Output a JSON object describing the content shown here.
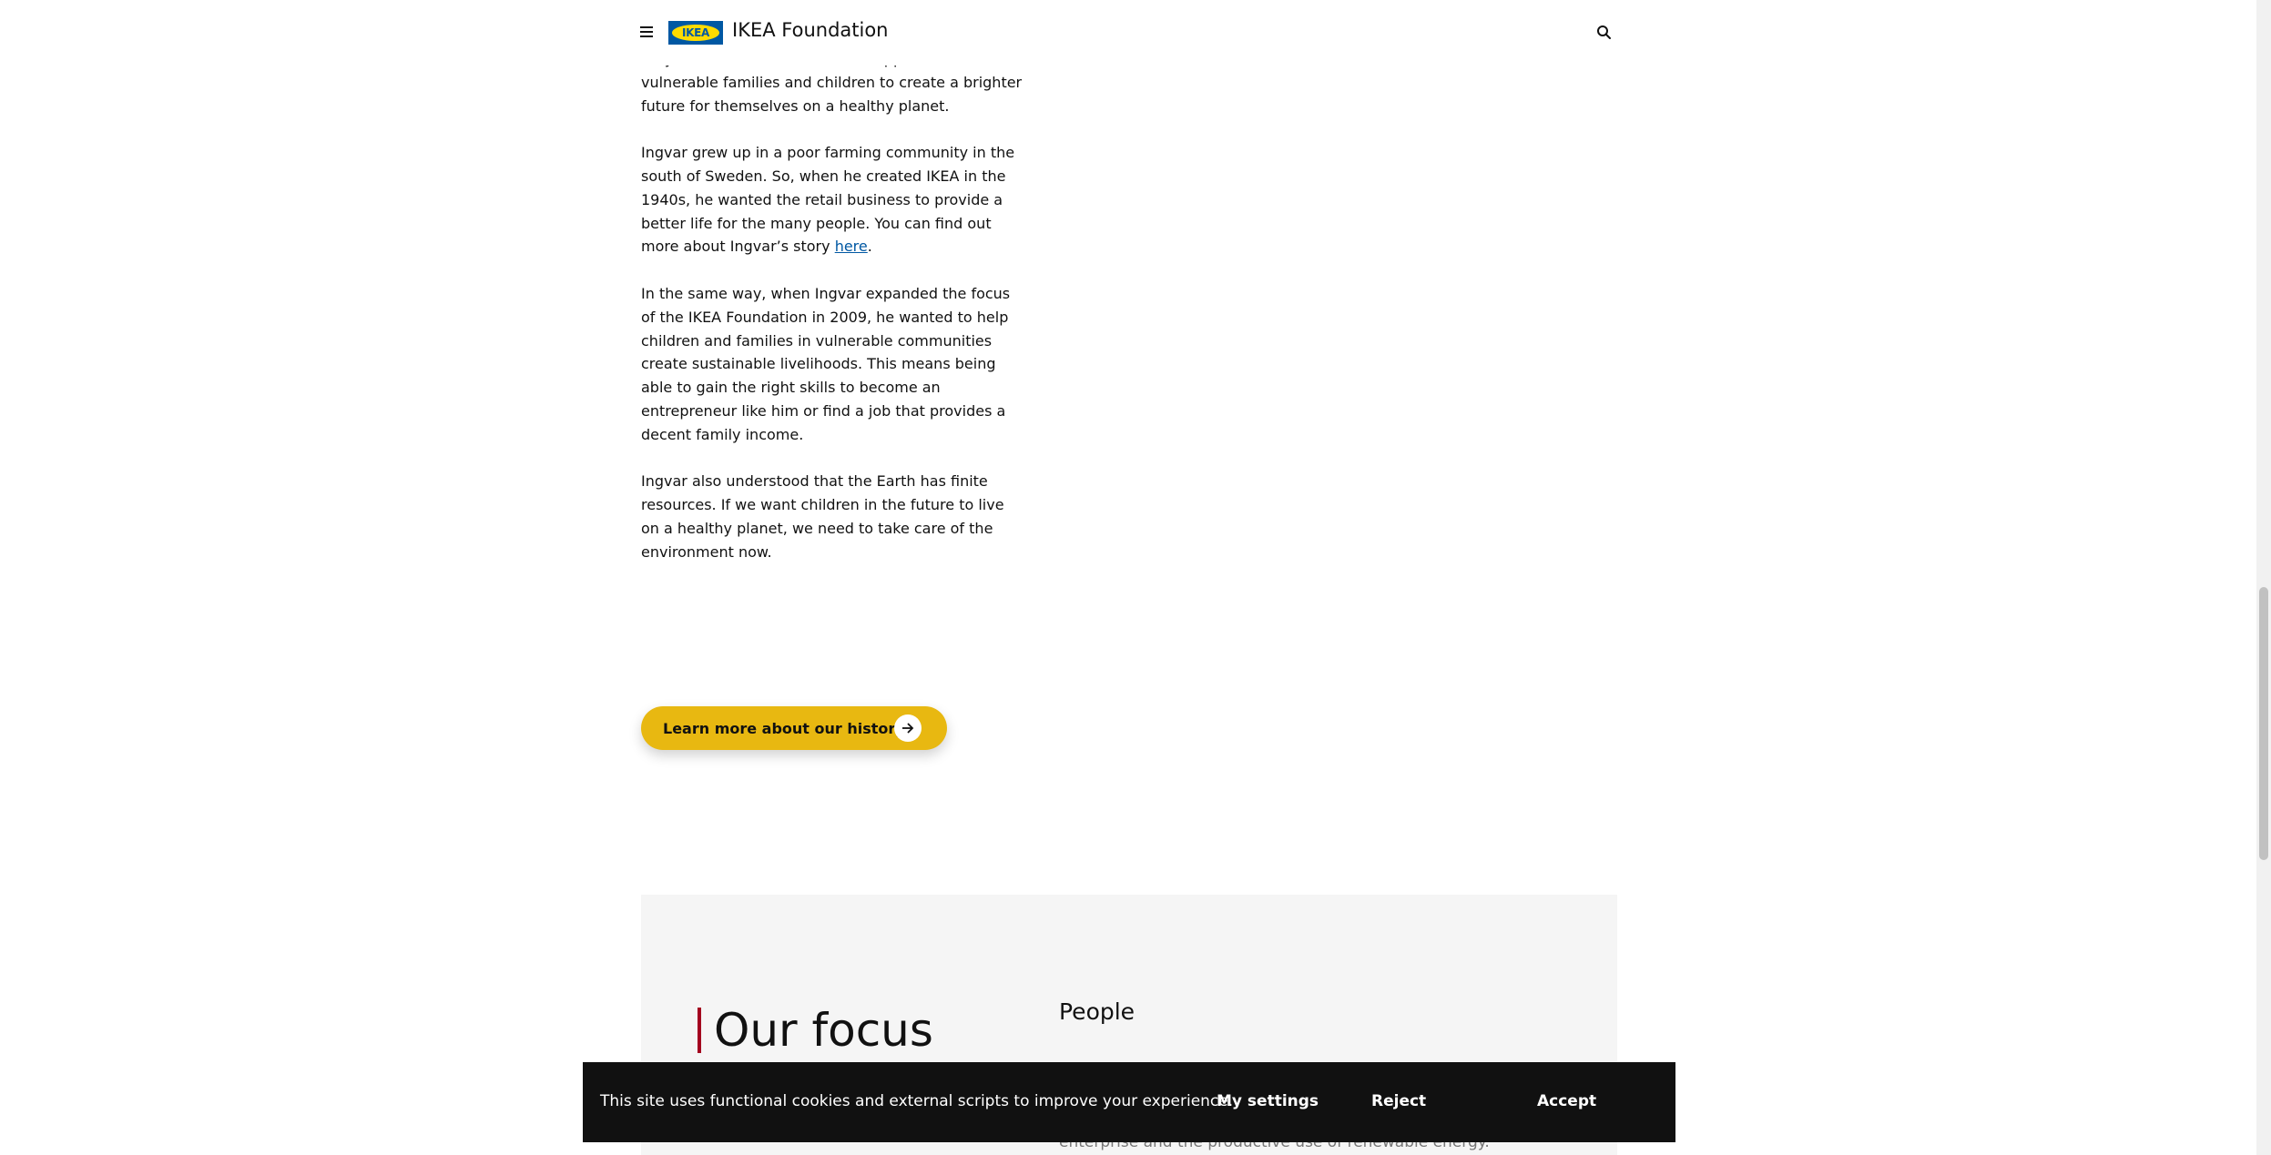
{
  "header": {
    "logo_text": "IKEA",
    "site_title": "IKEA Foundation"
  },
  "article": {
    "p1": "very clear. He wanted to create opportunities for vulnerable families and children to create a brighter future for themselves on a healthy planet.",
    "p2_before_link": "Ingvar grew up in a poor farming community in the south of Sweden. So, when he created IKEA in the 1940s, he wanted the retail business to provide a better life for the many people. You can find out more about Ingvar’s story ",
    "p2_link": "here",
    "p2_after_link": ".",
    "p3": "In the same way, when Ingvar expanded the focus of the IKEA Foundation in 2009, he wanted to help children and families in vulnerable communities create sustainable livelihoods. This means being able to gain the right skills to become an entrepreneur like him or find a job that provides a decent family income.",
    "p4": "Ingvar also understood that the Earth has finite resources. If we want children in the future to live on a healthy planet, we need to take care of the environment now."
  },
  "cta": {
    "label": "Learn more about our history"
  },
  "focus": {
    "heading": "Our focus",
    "subheading": "People",
    "faded_text": "enterprise and the productive use of renewable energy."
  },
  "cookie_banner": {
    "message": "This site uses functional cookies and external scripts to improve your experience.",
    "settings_label": "My settings",
    "reject_label": "Reject",
    "accept_label": "Accept"
  },
  "colors": {
    "ikea_blue": "#0058a3",
    "ikea_yellow": "#ffdb00",
    "cta_yellow": "#e8b811",
    "accent_red": "#a3001e",
    "banner_bg": "#111111"
  }
}
